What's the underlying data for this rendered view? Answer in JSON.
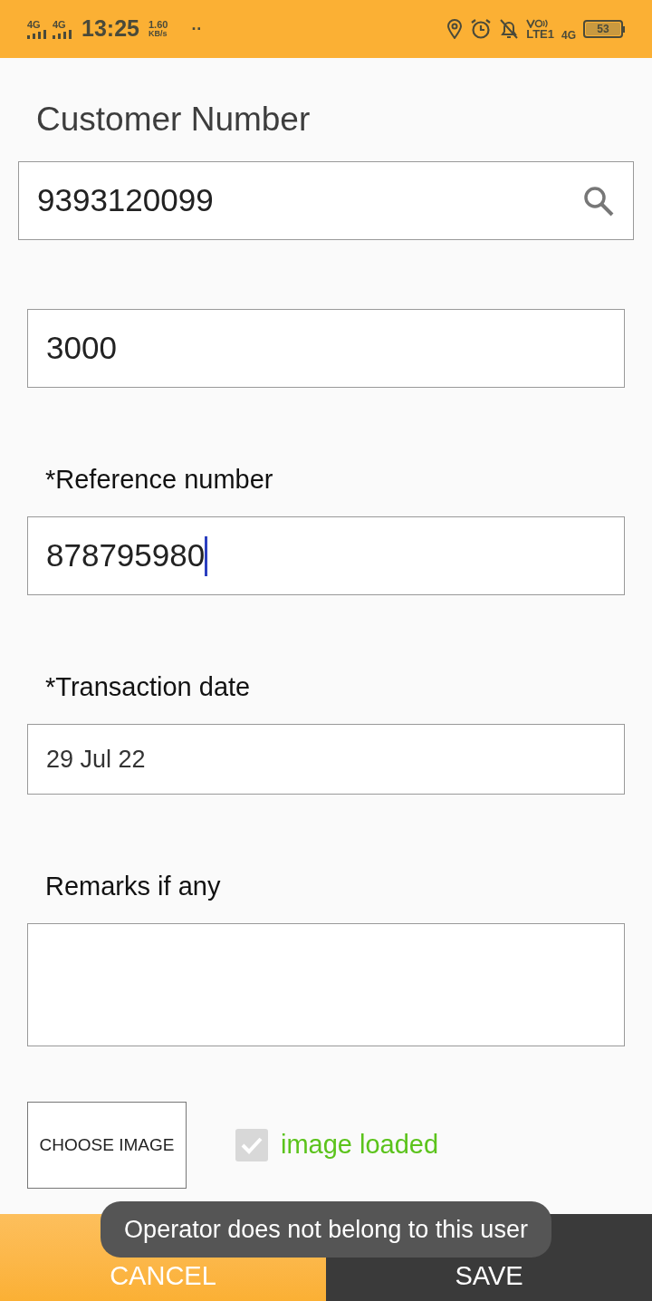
{
  "status_bar": {
    "network_1": "4G",
    "network_2": "4G",
    "time": "13:25",
    "speed": "1.60",
    "speed_unit": "KB/s",
    "dots": "··",
    "volte": "LTE1",
    "network_3": "4G",
    "battery": "53"
  },
  "customer": {
    "label": "Customer Number",
    "value": "9393120099"
  },
  "amount": {
    "value": "3000"
  },
  "reference": {
    "label": "*Reference number",
    "value": "878795980",
    "focused": true
  },
  "date": {
    "label": "*Transaction date",
    "value": "29 Jul 22"
  },
  "remarks": {
    "label": "Remarks if any"
  },
  "image": {
    "button": "CHOOSE IMAGE",
    "checked": true,
    "disabled": true,
    "status": "image loaded"
  },
  "buttons": [
    {
      "kind": "cancel",
      "label": "CANCEL"
    },
    {
      "kind": "save",
      "label": "SAVE"
    }
  ],
  "toast": "Operator does not belong to this user"
}
